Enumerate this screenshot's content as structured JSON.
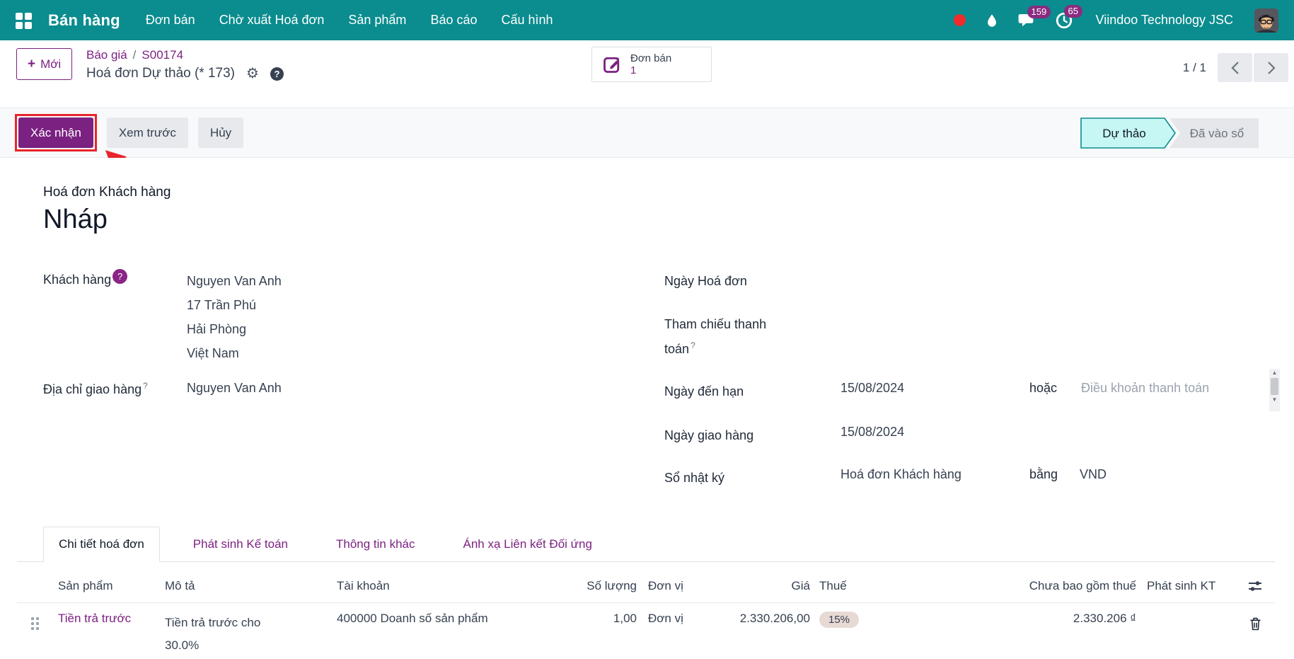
{
  "navbar": {
    "app_name": "Bán hàng",
    "items": [
      {
        "label": "Đơn bán"
      },
      {
        "label": "Chờ xuất Hoá đơn"
      },
      {
        "label": "Sản phẩm"
      },
      {
        "label": "Báo cáo"
      },
      {
        "label": "Cấu hình"
      }
    ],
    "messages_badge": "159",
    "activities_badge": "65",
    "company": "Viindoo Technology JSC",
    "icons": [
      "apps-grid-icon",
      "record-dot-icon",
      "droplet-icon",
      "messages-icon",
      "activities-clock-icon",
      "avatar"
    ]
  },
  "control_panel": {
    "new_button": {
      "plus": "+",
      "label": "Mới"
    },
    "breadcrumb": {
      "parent": "Báo giá",
      "separator": "/",
      "current": "S00174"
    },
    "title": "Hoá đơn Dự thảo (* 173)",
    "gear_icon": "⚙",
    "stat_button": {
      "label": "Đơn bán",
      "count": "1"
    },
    "pager": {
      "value": "1 / 1"
    }
  },
  "statusbar": {
    "buttons": [
      {
        "label": "Xác nhận"
      },
      {
        "label": "Xem trước"
      },
      {
        "label": "Hủy"
      }
    ],
    "states": [
      {
        "label": "Dự thảo"
      },
      {
        "label": "Đã vào sổ"
      }
    ]
  },
  "form": {
    "doc_type": "Hoá đơn Khách hàng",
    "doc_state": "Nháp",
    "customer": {
      "label": "Khách hàng",
      "help": "?",
      "lines": [
        "Nguyen Van Anh",
        "17 Trần Phú",
        "Hải Phòng",
        "Việt Nam"
      ]
    },
    "delivery_address": {
      "label": "Địa chỉ giao hàng",
      "sup": "?",
      "value": "Nguyen Van Anh"
    },
    "invoice_date": {
      "label": "Ngày Hoá đơn",
      "value": ""
    },
    "payment_ref": {
      "label": "Tham chiếu thanh toán",
      "sup": "?",
      "value": ""
    },
    "due_date": {
      "label": "Ngày đến hạn",
      "value": "15/08/2024",
      "or": "hoặc",
      "terms_placeholder": "Điều khoản thanh toán"
    },
    "delivery_date": {
      "label": "Ngày giao hàng",
      "value": "15/08/2024"
    },
    "journal": {
      "label": "Sổ nhật ký",
      "value": "Hoá đơn Khách hàng",
      "in": "bằng",
      "currency": "VND"
    }
  },
  "tabs": [
    {
      "label": "Chi tiết hoá đơn"
    },
    {
      "label": "Phát sinh Kế toán"
    },
    {
      "label": "Thông tin khác"
    },
    {
      "label": "Ánh xạ Liên kết Đối ứng"
    }
  ],
  "table": {
    "headers": [
      "Sản phẩm",
      "Mô tả",
      "Tài khoản",
      "Số lượng",
      "Đơn vị",
      "Giá",
      "Thuế",
      "Chưa bao gồm thuế",
      "Phát sinh KT"
    ],
    "row": {
      "product": "Tiền trả trước",
      "description": "Tiền trả trước cho 30.0%",
      "account": "400000 Doanh số sản phẩm",
      "quantity": "1,00",
      "uom": "Đơn vị",
      "price": "2.330.206,00",
      "tax": "15%",
      "subtotal": "2.330.206 ₫"
    }
  },
  "colors": {
    "navbar_teal": "#0b8c8e",
    "primary_purple": "#7b2182",
    "link_purple": "#7c2182",
    "badge_magenta": "#8a2b80",
    "status_active_bg": "#c6f7f5",
    "annotation_red": "#e8252b",
    "tax_badge_bg": "#e7d9d4"
  }
}
